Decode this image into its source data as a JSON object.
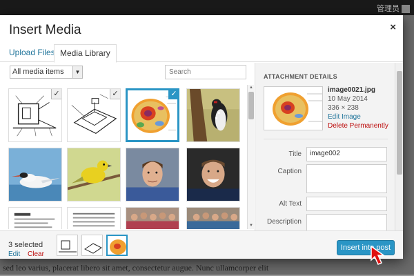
{
  "adminbar": {
    "user_text": "管理员"
  },
  "modal": {
    "title": "Insert Media",
    "close_glyph": "×"
  },
  "tabs": [
    {
      "label": "Upload Files"
    },
    {
      "label": "Media Library"
    }
  ],
  "toolbar": {
    "filter_value": "All media items",
    "search_placeholder": "Search"
  },
  "attachment": {
    "heading": "ATTACHMENT DETAILS",
    "filename": "image0021.jpg",
    "date": "10 May 2014",
    "dimensions": "336 × 238",
    "edit_label": "Edit Image",
    "delete_label": "Delete Permanently"
  },
  "fields": {
    "title_label": "Title",
    "title_value": "image002",
    "caption_label": "Caption",
    "alt_label": "Alt Text",
    "description_label": "Description"
  },
  "footer": {
    "selected_text": "3 selected",
    "edit_label": "Edit",
    "clear_label": "Clear",
    "insert_label": "Insert into post"
  },
  "background_text": "sed leo varius, placerat libero sit amet, consectetur augue. Nunc ullamcorper elit",
  "colors": {
    "accent": "#2a95c5",
    "link": "#21759b",
    "danger": "#bc0b0b"
  },
  "icons": [
    "close-icon",
    "checkmark-icon",
    "dropdown-arrow-icon",
    "cursor-arrow-icon"
  ]
}
